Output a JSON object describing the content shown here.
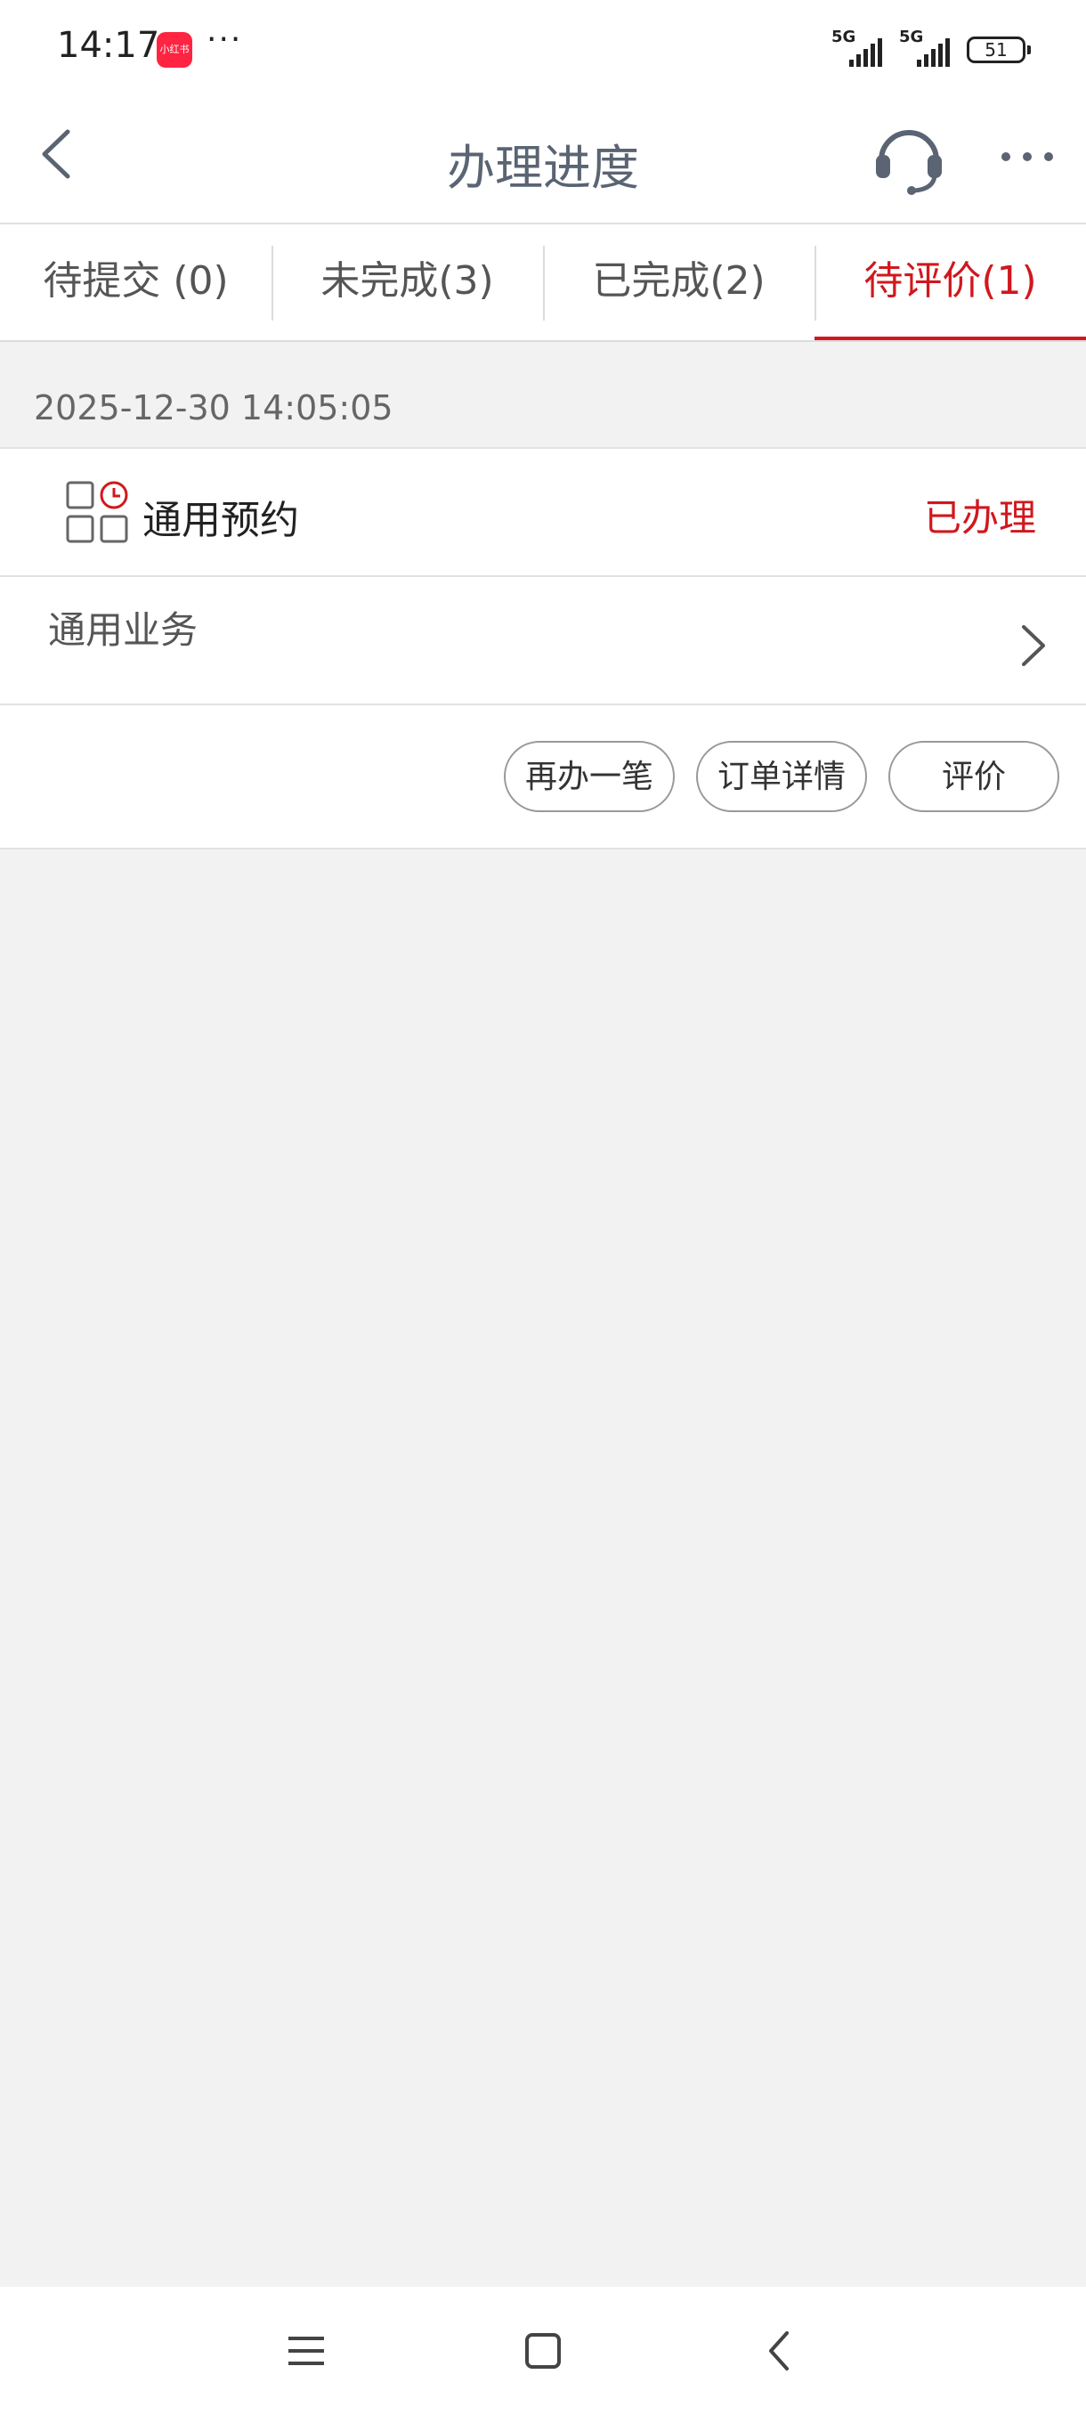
{
  "status_bar": {
    "time": "14:17",
    "app_icon_label": "小红书",
    "more_dots": "···",
    "network_1": "5G",
    "network_2": "5G",
    "battery": "51"
  },
  "navbar": {
    "title": "办理进度",
    "back_icon": "chevron-left-icon",
    "service_icon": "headset-icon",
    "more_icon": "more-horizontal-icon"
  },
  "tabs": [
    {
      "label": "待提交 (0)",
      "active": false
    },
    {
      "label": "未完成(3)",
      "active": false
    },
    {
      "label": "已完成(2)",
      "active": false
    },
    {
      "label": "待评价(1)",
      "active": true
    }
  ],
  "record": {
    "datetime": "2025-12-30 14:05:05",
    "service_name": "通用预约",
    "status": "已办理",
    "category": "通用业务",
    "actions": {
      "again": "再办一笔",
      "detail": "订单详情",
      "rate": "评价"
    }
  },
  "colors": {
    "accent": "#d0181e",
    "page_bg": "#f2f2f2",
    "title_gray": "#5a6472"
  },
  "system_nav": {
    "menu_icon": "menu-icon",
    "home_icon": "home-square-icon",
    "back_icon": "back-chevron-icon"
  }
}
